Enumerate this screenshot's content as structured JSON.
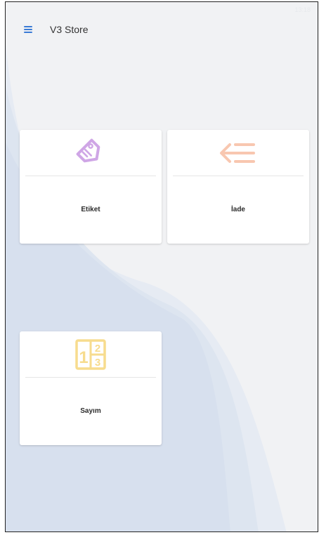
{
  "status_bar": {
    "time": "13:18"
  },
  "header": {
    "title": "V3 Store",
    "menu_icon": "hamburger-menu-icon"
  },
  "cards": [
    {
      "label": "Etiket",
      "icon": "tag-icon",
      "icon_color": "#cfa6e6"
    },
    {
      "label": "İade",
      "icon": "return-arrow-icon",
      "icon_color": "#f8c7b0"
    },
    {
      "label": "Sayım",
      "icon": "count-numbers-icon",
      "icon_color": "#f7dc8e"
    }
  ],
  "colors": {
    "accent": "#3a7bd5",
    "background": "#f1f2f4",
    "wave": "#dde5f0"
  }
}
